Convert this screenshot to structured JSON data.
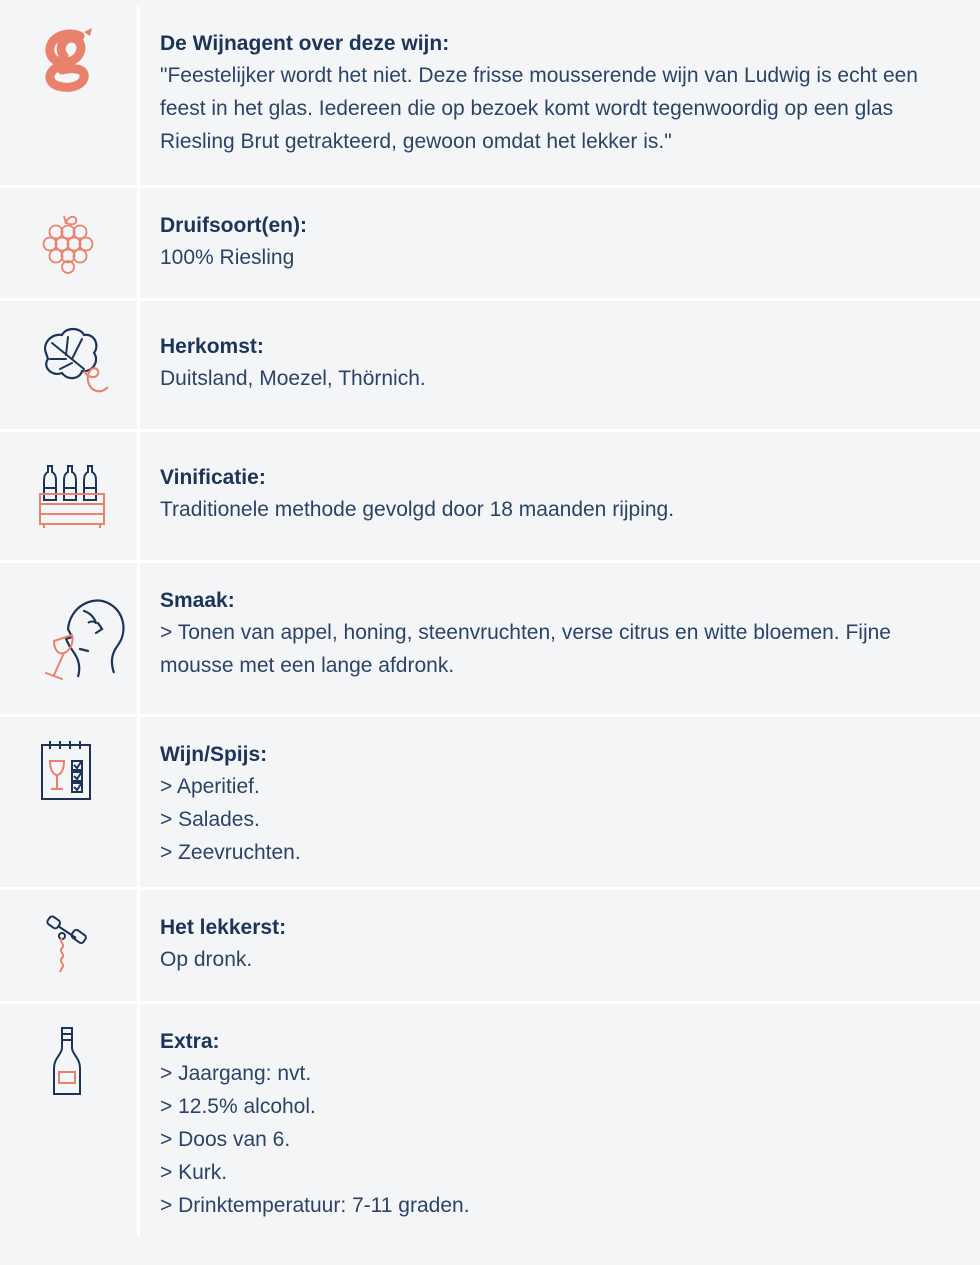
{
  "colors": {
    "navy": "#1c3457",
    "salmon": "#e8826d",
    "background": "#f4f5f7"
  },
  "rows": [
    {
      "icon": "logo-g-icon",
      "label": "De Wijnagent over deze wijn:",
      "value": "\"Feestelijker wordt het niet. Deze frisse mousserende wijn van Ludwig is echt een feest in het glas. Iedereen die op bezoek komt wordt tegenwoordig op een glas Riesling Brut getrakteerd, gewoon omdat het lekker is.\""
    },
    {
      "icon": "grapes-icon",
      "label": "Druifsoort(en):",
      "value": "100% Riesling"
    },
    {
      "icon": "vine-leaf-icon",
      "label": "Herkomst:",
      "value": "Duitsland, Moezel, Thörnich."
    },
    {
      "icon": "wine-crate-icon",
      "label": "Vinificatie:",
      "value": "Traditionele methode gevolgd door 18 maanden rijping."
    },
    {
      "icon": "tasting-face-icon",
      "label": "Smaak:",
      "value": "> Tonen van appel, honing, steenvruchten, verse citrus en witte bloemen. Fijne mousse met een lange afdronk."
    },
    {
      "icon": "pairing-checklist-icon",
      "label": "Wijn/Spijs:",
      "lines": [
        "> Aperitief.",
        "> Salades.",
        "> Zeevruchten."
      ]
    },
    {
      "icon": "corkscrew-icon",
      "label": "Het lekkerst:",
      "value": "Op dronk."
    },
    {
      "icon": "champagne-bottle-icon",
      "label": "Extra:",
      "lines": [
        "> Jaargang: nvt.",
        "> 12.5% alcohol.",
        "> Doos van 6.",
        "> Kurk.",
        "> Drinktemperatuur: 7-11 graden."
      ]
    }
  ]
}
